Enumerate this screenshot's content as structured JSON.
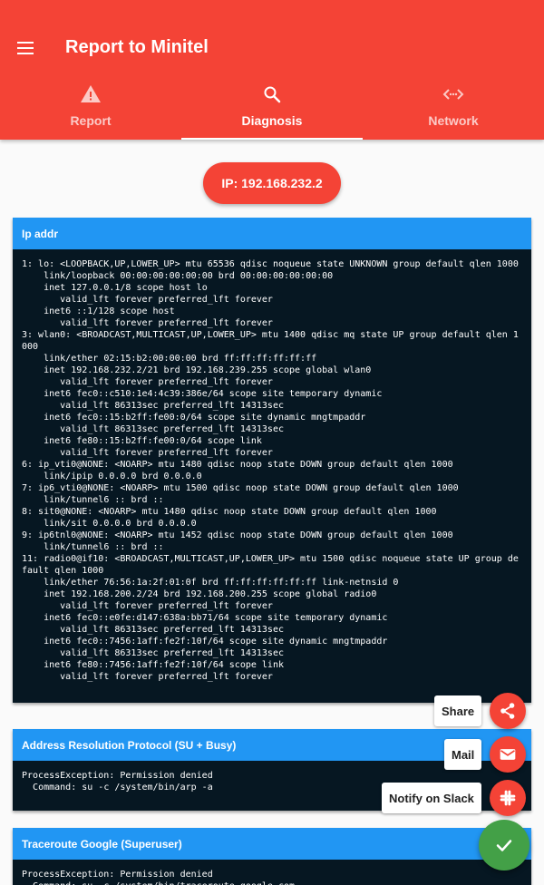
{
  "colors": {
    "appbar": "#f44336",
    "card_header": "#2196f3",
    "terminal_bg": "#061722",
    "fab_main": "#43a047"
  },
  "appbar": {
    "title": "Report to Minitel",
    "menu_icon": "menu-icon"
  },
  "tabs": [
    {
      "label": "Report",
      "icon": "warning-icon",
      "active": false
    },
    {
      "label": "Diagnosis",
      "icon": "search-icon",
      "active": true
    },
    {
      "label": "Network",
      "icon": "code-icon",
      "active": false
    }
  ],
  "ip_button": {
    "label": "IP: 192.168.232.2"
  },
  "cards": [
    {
      "title": "Ip addr",
      "output": "1: lo: <LOOPBACK,UP,LOWER_UP> mtu 65536 qdisc noqueue state UNKNOWN group default qlen 1000\n    link/loopback 00:00:00:00:00:00 brd 00:00:00:00:00:00\n    inet 127.0.0.1/8 scope host lo\n       valid_lft forever preferred_lft forever\n    inet6 ::1/128 scope host\n       valid_lft forever preferred_lft forever\n3: wlan0: <BROADCAST,MULTICAST,UP,LOWER_UP> mtu 1400 qdisc mq state UP group default qlen 1000\n    link/ether 02:15:b2:00:00:00 brd ff:ff:ff:ff:ff:ff\n    inet 192.168.232.2/21 brd 192.168.239.255 scope global wlan0\n       valid_lft forever preferred_lft forever\n    inet6 fec0::c510:1e4:4c39:386e/64 scope site temporary dynamic\n       valid_lft 86313sec preferred_lft 14313sec\n    inet6 fec0::15:b2ff:fe00:0/64 scope site dynamic mngtmpaddr\n       valid_lft 86313sec preferred_lft 14313sec\n    inet6 fe80::15:b2ff:fe00:0/64 scope link\n       valid_lft forever preferred_lft forever\n6: ip_vti0@NONE: <NOARP> mtu 1480 qdisc noop state DOWN group default qlen 1000\n    link/ipip 0.0.0.0 brd 0.0.0.0\n7: ip6_vti0@NONE: <NOARP> mtu 1500 qdisc noop state DOWN group default qlen 1000\n    link/tunnel6 :: brd ::\n8: sit0@NONE: <NOARP> mtu 1480 qdisc noop state DOWN group default qlen 1000\n    link/sit 0.0.0.0 brd 0.0.0.0\n9: ip6tnl0@NONE: <NOARP> mtu 1452 qdisc noop state DOWN group default qlen 1000\n    link/tunnel6 :: brd ::\n11: radio0@if10: <BROADCAST,MULTICAST,UP,LOWER_UP> mtu 1500 qdisc noqueue state UP group default qlen 1000\n    link/ether 76:56:1a:2f:01:0f brd ff:ff:ff:ff:ff:ff link-netnsid 0\n    inet 192.168.200.2/24 brd 192.168.200.255 scope global radio0\n       valid_lft forever preferred_lft forever\n    inet6 fec0::e0fe:d147:638a:bb71/64 scope site temporary dynamic\n       valid_lft 86313sec preferred_lft 14313sec\n    inet6 fec0::7456:1aff:fe2f:10f/64 scope site dynamic mngtmpaddr\n       valid_lft 86313sec preferred_lft 14313sec\n    inet6 fe80::7456:1aff:fe2f:10f/64 scope link\n       valid_lft forever preferred_lft forever"
    },
    {
      "title": "Address Resolution Protocol (SU + Busy)",
      "output": "ProcessException: Permission denied\n  Command: su -c /system/bin/arp -a"
    },
    {
      "title": "Traceroute Google (Superuser)",
      "output": "ProcessException: Permission denied\n  Command: su -c /system/bin/traceroute google.com"
    }
  ],
  "fab_menu": {
    "share_label": "Share",
    "mail_label": "Mail",
    "slack_label": "Notify on Slack",
    "main_icon": "check-icon"
  }
}
